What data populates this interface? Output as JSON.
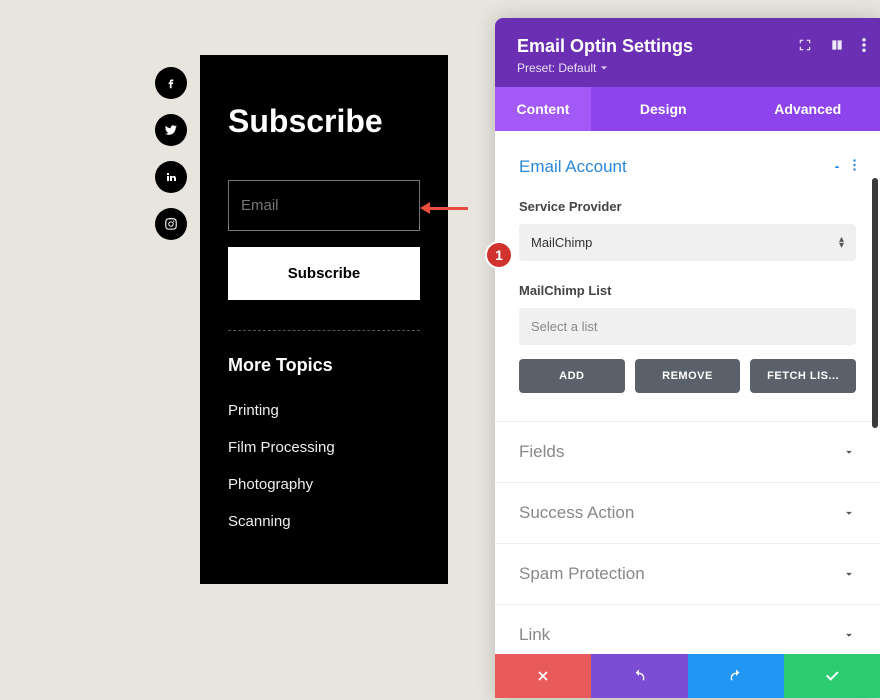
{
  "subscribe": {
    "title": "Subscribe",
    "email_placeholder": "Email",
    "button_label": "Subscribe",
    "more_topics_title": "More Topics",
    "topics": [
      "Printing",
      "Film Processing",
      "Photography",
      "Scanning"
    ]
  },
  "badge": {
    "number": "1"
  },
  "panel": {
    "title": "Email Optin Settings",
    "preset_label": "Preset: Default",
    "tabs": {
      "content": "Content",
      "design": "Design",
      "advanced": "Advanced"
    },
    "email_account": {
      "title": "Email Account",
      "service_provider_label": "Service Provider",
      "service_provider_value": "MailChimp",
      "list_label": "MailChimp List",
      "list_placeholder": "Select a list",
      "add_label": "ADD",
      "remove_label": "REMOVE",
      "fetch_label": "FETCH LIS..."
    },
    "sections": {
      "fields": "Fields",
      "success_action": "Success Action",
      "spam_protection": "Spam Protection",
      "link": "Link"
    }
  }
}
